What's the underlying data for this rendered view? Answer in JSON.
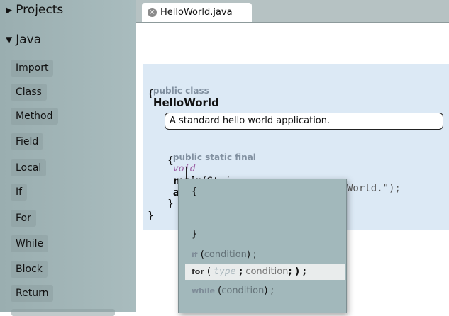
{
  "sidebar": {
    "sections": [
      {
        "label": "Projects",
        "arrow": "▶"
      },
      {
        "label": "Java",
        "arrow": "▼"
      }
    ],
    "items": [
      {
        "label": "Import"
      },
      {
        "label": "Class"
      },
      {
        "label": "Method"
      },
      {
        "label": "Field"
      },
      {
        "label": "Local"
      },
      {
        "label": "If"
      },
      {
        "label": "For"
      },
      {
        "label": "While"
      },
      {
        "label": "Block"
      },
      {
        "label": "Return"
      }
    ]
  },
  "tab": {
    "label": "HelloWorld.java",
    "close_icon": "×"
  },
  "code": {
    "class_kw": "public class",
    "class_name": "HelloWorld",
    "open_brace": "{",
    "close_brace": "}",
    "comment": "A standard hello world application.",
    "method_kw": "public static final",
    "return_type": "void",
    "method_name": "main",
    "param_open": "(",
    "param_type": "String",
    "param_name": "args",
    "param_close": ")",
    "method_open": "{",
    "method_close": "}",
    "partial_line": "World.\");"
  },
  "popup": {
    "items": [
      {
        "open": "{"
      },
      {
        "close": "}"
      },
      {
        "kw": "if",
        "open": " (",
        "cond": "condition",
        "close": ") ;"
      },
      {
        "kw": "for",
        "open": " ( ",
        "ghost": "type",
        "semi1": " ;",
        "cond": " condition",
        "close": "; ) ;"
      },
      {
        "kw": "while",
        "open": " (",
        "cond": "condition",
        "close": ") ;"
      }
    ]
  }
}
